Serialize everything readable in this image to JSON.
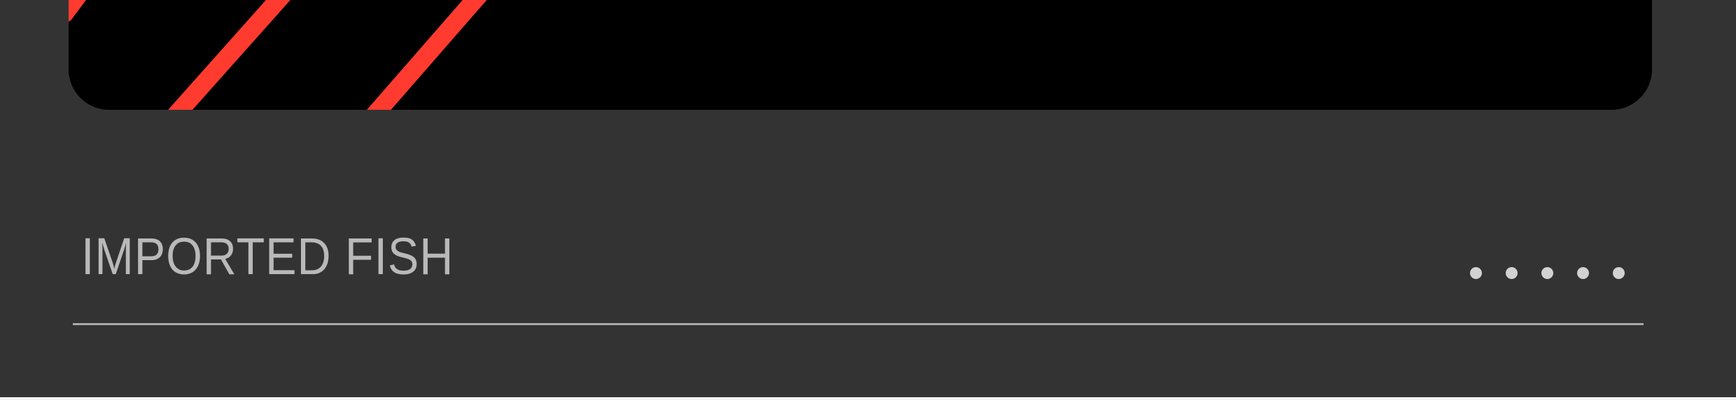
{
  "section": {
    "title": "IMPORTED FISH",
    "more_icon": "ellipsis-dots-icon",
    "dot_count": 5
  },
  "media": {
    "stripe_color": "#ff3b30",
    "background_color": "#000000"
  },
  "theme": {
    "page_background": "#333333",
    "title_color": "#b9b9b9",
    "divider_color": "#a9a9a9"
  }
}
